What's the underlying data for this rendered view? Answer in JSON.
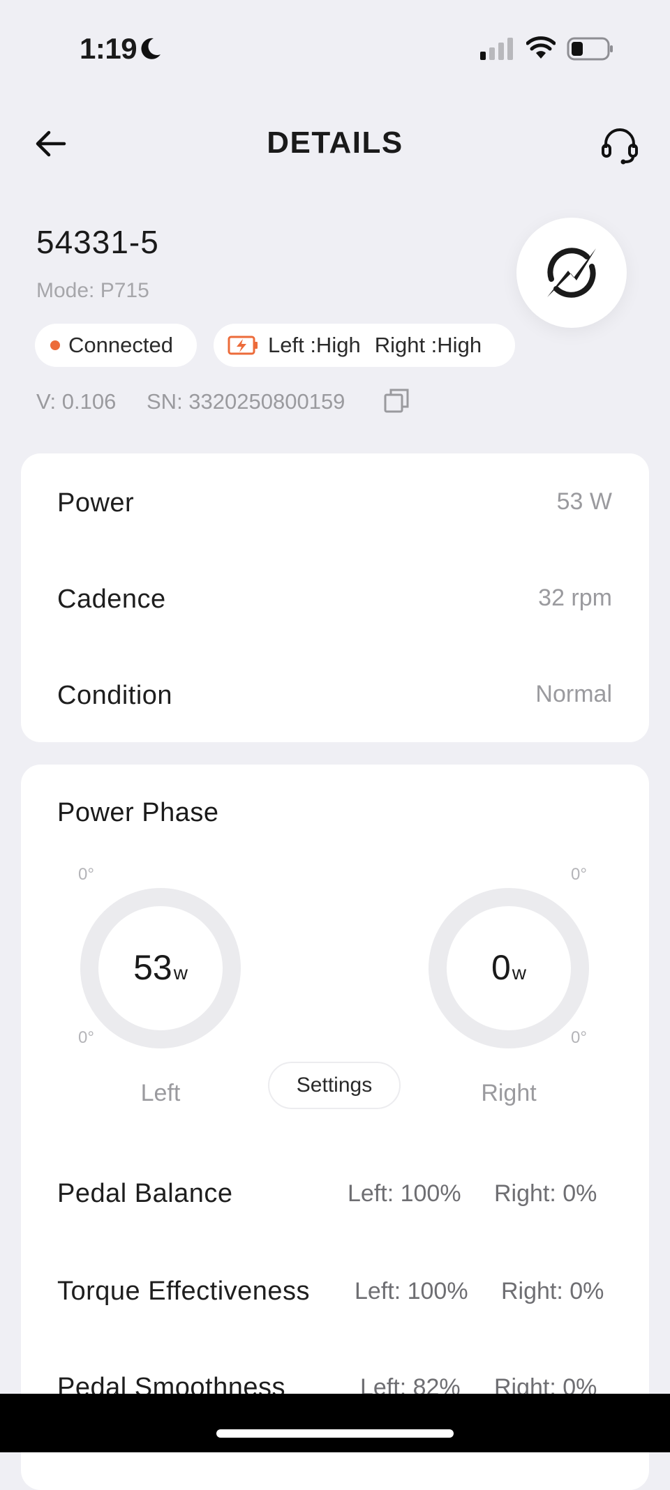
{
  "status_bar": {
    "time": "1:19",
    "icons": [
      "moon-icon",
      "signal-icon",
      "wifi-icon",
      "battery-icon"
    ]
  },
  "header": {
    "title": "DETAILS",
    "back_icon": "arrow-left-icon",
    "support_icon": "headset-icon"
  },
  "device": {
    "name": "54331-5",
    "mode": "Mode: P715",
    "connection": "Connected",
    "battery_left": "Left :High",
    "battery_right": "Right :High",
    "version": "V: 0.106",
    "serial": "SN: 3320250800159",
    "logo_icon": "power-bolt-logo",
    "accent_color": "#ec6b3a"
  },
  "stats": [
    {
      "label": "Power",
      "value": "53 W"
    },
    {
      "label": "Cadence",
      "value": "32 rpm"
    },
    {
      "label": "Condition",
      "value": "Normal"
    }
  ],
  "power_phase": {
    "title": "Power Phase",
    "left": {
      "value": "53",
      "unit": "w",
      "label": "Left",
      "top_deg": "0°",
      "bottom_deg": "0°"
    },
    "right": {
      "value": "0",
      "unit": "w",
      "label": "Right",
      "top_deg": "0°",
      "bottom_deg": "0°"
    },
    "settings_label": "Settings"
  },
  "metrics": [
    {
      "label": "Pedal Balance",
      "left": "Left: 100%",
      "right": "Right: 0%"
    },
    {
      "label": "Torque Effectiveness",
      "left": "Left: 100%",
      "right": "Right: 0%"
    },
    {
      "label": "Pedal Smoothness",
      "left": "Left: 82%",
      "right": "Right: 0%"
    }
  ]
}
